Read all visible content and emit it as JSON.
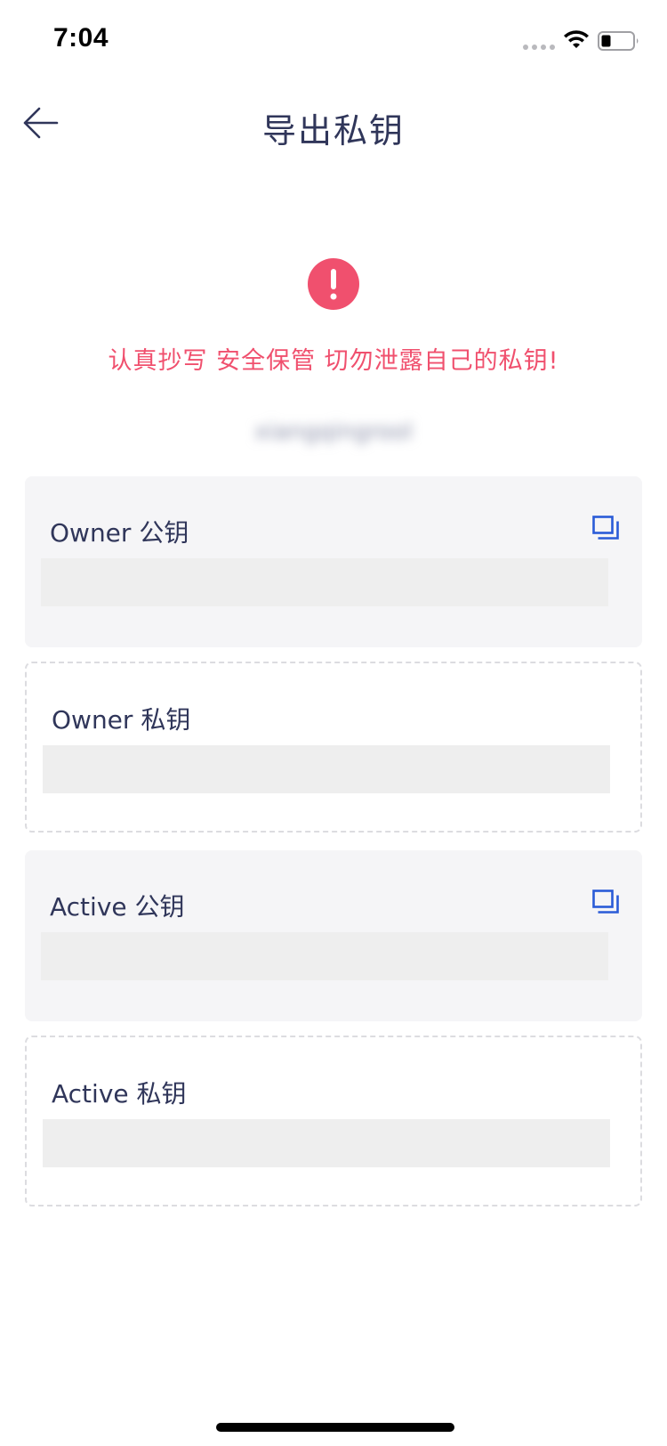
{
  "status_bar": {
    "time": "7:04"
  },
  "header": {
    "title": "导出私钥",
    "back_icon": "arrow-left-icon"
  },
  "warning": {
    "icon": "exclamation-circle-icon",
    "color": "#f0506e",
    "text": "认真抄写 安全保管 切勿泄露自己的私钥!"
  },
  "account": {
    "name": "xiangqingrool"
  },
  "keys": [
    {
      "label": "Owner 公钥",
      "type": "public",
      "copy_icon": "copy-icon",
      "value": ""
    },
    {
      "label": "Owner 私钥",
      "type": "private",
      "value": ""
    },
    {
      "label": "Active 公钥",
      "type": "public",
      "copy_icon": "copy-icon",
      "value": ""
    },
    {
      "label": "Active 私钥",
      "type": "private",
      "value": ""
    }
  ],
  "colors": {
    "accent_blue": "#2a5bd7",
    "title": "#30365a",
    "alert_red": "#f0506e",
    "card_bg": "#f5f5f7",
    "redaction": "#eeeeee"
  }
}
